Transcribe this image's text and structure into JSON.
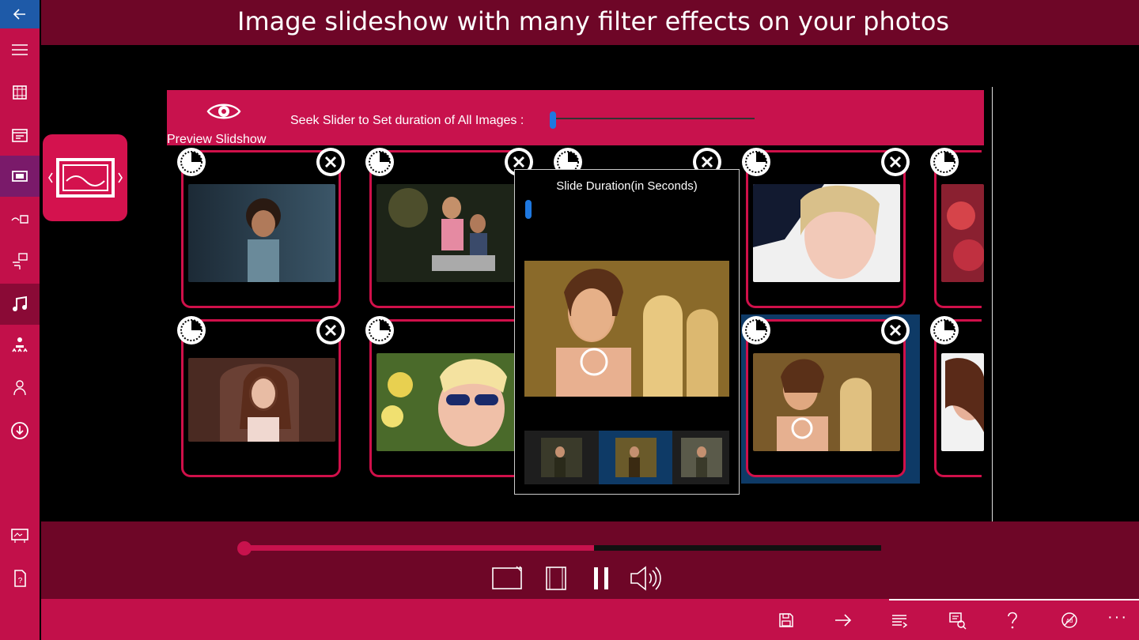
{
  "header": {
    "title": "Image slideshow with  many filter effects on your photos"
  },
  "sidebar": {
    "items": [
      {
        "icon": "back-arrow-icon"
      },
      {
        "icon": "hamburger-menu-icon"
      },
      {
        "icon": "film-strip-icon"
      },
      {
        "icon": "slideshow-frame-icon"
      },
      {
        "icon": "slideshow-active-icon"
      },
      {
        "icon": "photo-transfer-icon"
      },
      {
        "icon": "photo-upload-icon"
      },
      {
        "icon": "music-note-icon"
      },
      {
        "icon": "people-rating-icon"
      },
      {
        "icon": "support-agent-icon"
      },
      {
        "icon": "download-icon"
      },
      {
        "icon": "billboard-icon"
      },
      {
        "icon": "help-document-icon"
      }
    ]
  },
  "editor": {
    "preview_label": "Preview Slidshow",
    "seek_label": "Seek Slider to Set duration of All Images :"
  },
  "popup": {
    "title": "Slide Duration(in Seconds)"
  },
  "colors": {
    "accent": "#c8124d",
    "dark": "#6e0627",
    "selected": "#0e3a66",
    "slider": "#1e78e0"
  },
  "player": {
    "progress_fraction": 0.55
  },
  "appbar": {
    "buttons": [
      "save-icon",
      "next-arrow-icon",
      "playlist-icon",
      "screen-share-icon",
      "help-icon",
      "no-ads-icon"
    ],
    "more": "···"
  }
}
